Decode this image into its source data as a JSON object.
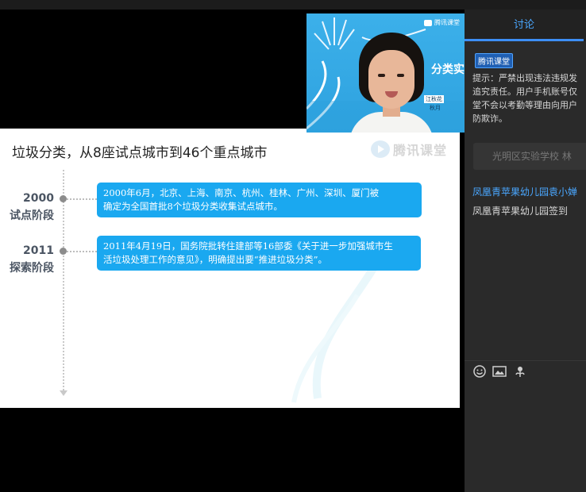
{
  "slide": {
    "title": "垃圾分类，从8座试点城市到46个重点城市",
    "watermark_text": "腾讯课堂",
    "stages": [
      {
        "year": "2000",
        "name": "试点阶段",
        "text_line1": "2000年6月，北京、上海、南京、杭州、桂林、广州、深圳、厦门被",
        "text_line2": "确定为全国首批8个垃圾分类收集试点城市。"
      },
      {
        "year": "2011",
        "name": "探索阶段",
        "text_line1": "2011年4月19日，国务院批转住建部等16部委《关于进一步加强城市生",
        "text_line2": "活垃圾处理工作的意见》，明确提出要“推进垃圾分类”。"
      }
    ]
  },
  "video": {
    "brand": "腾讯课堂",
    "title_fragment": "分类实",
    "caption_name": "江秋花",
    "caption_extra": "秋月"
  },
  "panel": {
    "tab_label": "讨论",
    "notice_badge": "腾讯课堂",
    "notice_text": "提示：严禁出现违法违规发\n追究责任。用户手机账号仅\n堂不会以考勤等理由向用户\n防欺诈。",
    "info_pill": "光明区实验学校 林",
    "message": {
      "sender": "凤凰青苹果幼儿园袁小婵",
      "text": "凤凰青苹果幼儿园签到"
    },
    "tools": [
      "emoji-icon",
      "image-icon",
      "flower-icon"
    ]
  },
  "colors": {
    "accent": "#1aa8f0",
    "panel_bg": "#2a2a2a",
    "link": "#4aa7ff"
  }
}
